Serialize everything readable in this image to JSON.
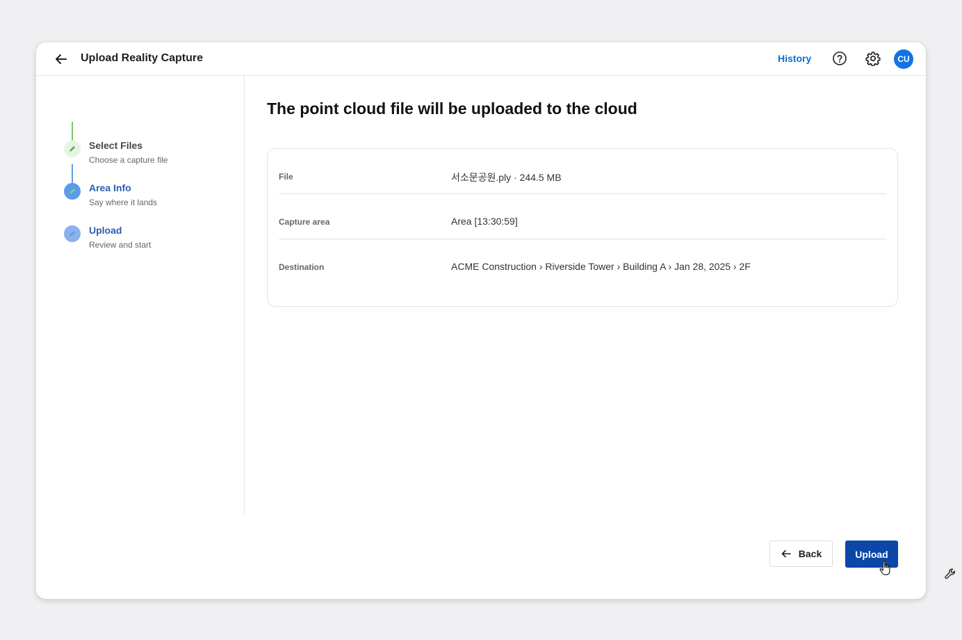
{
  "header": {
    "title": "Upload Reality Capture",
    "history_label": "History",
    "avatar_initials": "CU"
  },
  "steps": [
    {
      "title": "Select Files",
      "subtitle": "Choose a capture file",
      "state": "done"
    },
    {
      "title": "Area Info",
      "subtitle": "Say where it lands",
      "state": "active"
    },
    {
      "title": "Upload",
      "subtitle": "Review and start",
      "state": "current"
    }
  ],
  "main": {
    "heading": "The point cloud file will be uploaded to the cloud",
    "summary": [
      {
        "label": "File",
        "value": "서소문공원.ply · 244.5 MB"
      },
      {
        "label": "Capture area",
        "value": "Area [13:30:59]"
      },
      {
        "label": "Destination",
        "value": "ACME Construction › Riverside Tower › Building A › Jan 28, 2025 › 2F"
      }
    ]
  },
  "footer": {
    "back_label": "Back",
    "upload_label": "Upload"
  },
  "colors": {
    "accent": "#0a47a8",
    "link": "#0d6fd1",
    "step_done": "#e6f4e3",
    "step_active": "#5b9bea",
    "step_current": "#8ab1f0"
  }
}
